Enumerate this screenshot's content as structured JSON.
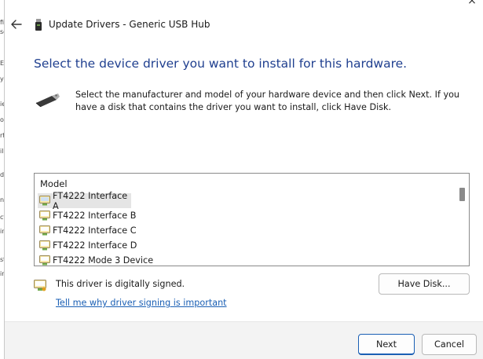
{
  "window": {
    "title": "Update Drivers - Generic USB Hub",
    "close_glyph": "×"
  },
  "page": {
    "heading": "Select the device driver you want to install for this hardware.",
    "description": "Select the manufacturer and model of your hardware device and then click Next. If you have a disk that contains the driver you want to install, click Have Disk."
  },
  "model_list": {
    "header": "Model",
    "selected_index": 0,
    "items": [
      {
        "label": "FT4222 Interface A"
      },
      {
        "label": "FT4222 Interface B"
      },
      {
        "label": "FT4222 Interface C"
      },
      {
        "label": "FT4222 Interface D"
      },
      {
        "label": "FT4222 Mode 3 Device"
      }
    ]
  },
  "signing": {
    "status": "This driver is digitally signed.",
    "link": "Tell me why driver signing is important"
  },
  "buttons": {
    "have_disk": "Have Disk...",
    "next": "Next",
    "cancel": "Cancel"
  },
  "background_window": {
    "fragments": [
      "fi",
      "sc",
      "E",
      "y",
      "ie",
      "ot",
      "rt",
      "ile",
      "d",
      "ne",
      "ct",
      "ine",
      "st",
      "ine"
    ]
  },
  "colors": {
    "heading": "#1f3f8f",
    "link": "#1a5fb4",
    "primary_border": "#1a5fb4",
    "selected_row": "#e5e5e5"
  },
  "icons": {
    "back": "back-arrow-icon",
    "title": "usb-device-icon",
    "hardware": "usb-plug-icon",
    "driver": "signed-driver-icon"
  }
}
